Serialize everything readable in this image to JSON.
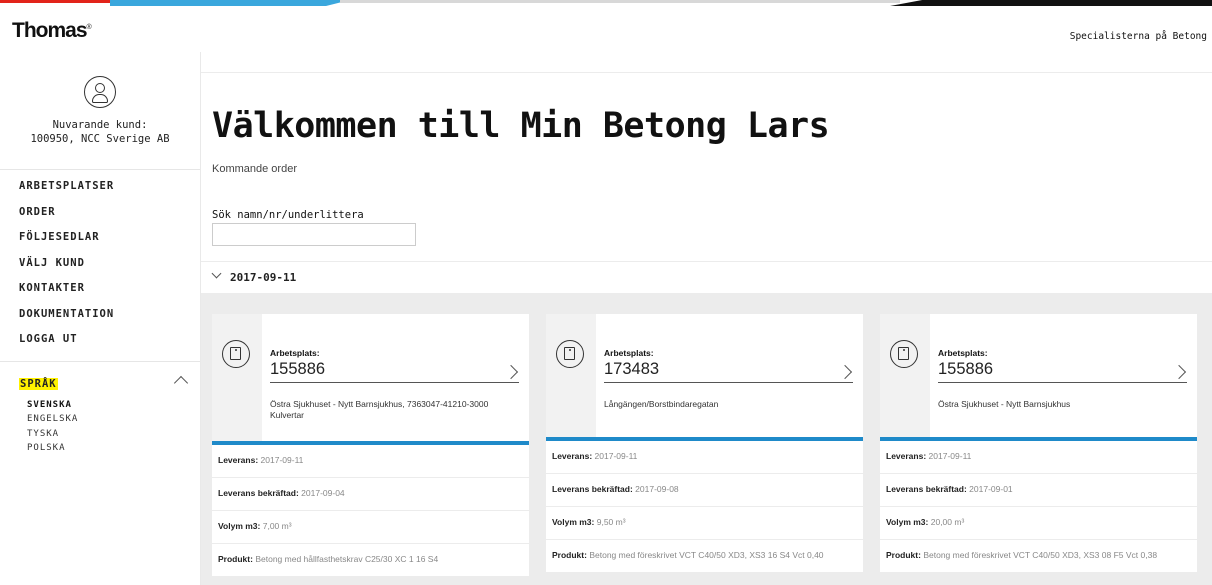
{
  "header": {
    "logo": "Thomas",
    "logo_mark": "®",
    "tagline": "Specialisterna på Betong"
  },
  "sidebar": {
    "customer_label": "Nuvarande kund:",
    "customer_value": "100950, NCC Sverige AB",
    "nav": [
      "ARBETSPLATSER",
      "ORDER",
      "FÖLJESEDLAR",
      "VÄLJ KUND",
      "KONTAKTER",
      "DOKUMENTATION",
      "LOGGA UT"
    ],
    "language_heading": "SPRÅK",
    "languages": [
      "SVENSKA",
      "ENGELSKA",
      "TYSKA",
      "POLSKA"
    ]
  },
  "main": {
    "title": "Välkommen till Min Betong Lars",
    "subtitle": "Kommande order",
    "search": {
      "label": "Sök namn/nr/underlittera",
      "value": "",
      "placeholder": ""
    },
    "date_group": "2017-09-11"
  },
  "cards": [
    {
      "workplace_label": "Arbetsplats:",
      "workplace_number": "155886",
      "address": "Östra Sjukhuset - Nytt Barnsjukhus, 7363047-41210-3000 Kulvertar",
      "rows": [
        {
          "label": "Leverans:",
          "value": "2017-09-11"
        },
        {
          "label": "Leverans bekräftad:",
          "value": "2017-09-04"
        },
        {
          "label": "Volym m3:",
          "value": "7,00 m³"
        },
        {
          "label": "Produkt:",
          "value": "Betong med hållfasthetskrav C25/30 XC 1 16 S4"
        }
      ]
    },
    {
      "workplace_label": "Arbetsplats:",
      "workplace_number": "173483",
      "address": "Långängen/Borstbindaregatan",
      "rows": [
        {
          "label": "Leverans:",
          "value": "2017-09-11"
        },
        {
          "label": "Leverans bekräftad:",
          "value": "2017-09-08"
        },
        {
          "label": "Volym m3:",
          "value": "9,50 m³"
        },
        {
          "label": "Produkt:",
          "value": "Betong med föreskrivet VCT C40/50 XD3, XS3 16 S4 Vct 0,40"
        }
      ]
    },
    {
      "workplace_label": "Arbetsplats:",
      "workplace_number": "155886",
      "address": "Östra Sjukhuset - Nytt Barnsjukhus",
      "rows": [
        {
          "label": "Leverans:",
          "value": "2017-09-11"
        },
        {
          "label": "Leverans bekräftad:",
          "value": "2017-09-01"
        },
        {
          "label": "Volym m3:",
          "value": "20,00 m³"
        },
        {
          "label": "Produkt:",
          "value": "Betong med föreskrivet VCT C40/50 XD3, XS3 08 F5 Vct 0,38"
        }
      ]
    }
  ],
  "colors": {
    "accent_blue": "#1f8ac9",
    "highlight": "#fff200",
    "brand_red": "#e2231a"
  }
}
